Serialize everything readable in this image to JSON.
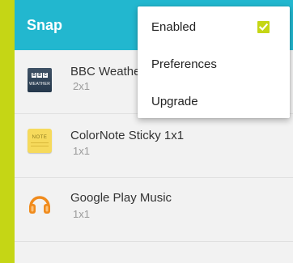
{
  "appbar": {
    "title": "Snap"
  },
  "list": {
    "items": [
      {
        "title": "BBC Weather",
        "subtitle": "2x1",
        "icon": "bbc-weather-icon",
        "icon_text": [
          "B",
          "B",
          "C"
        ],
        "icon_caption": "WEATHER"
      },
      {
        "title": "ColorNote Sticky 1x1",
        "subtitle": "1x1",
        "icon": "colornote-icon",
        "icon_caption": "NOTE"
      },
      {
        "title": "Google Play Music",
        "subtitle": "1x1",
        "icon": "headphones-icon"
      }
    ]
  },
  "menu": {
    "items": [
      {
        "label": "Enabled",
        "checked": true
      },
      {
        "label": "Preferences"
      },
      {
        "label": "Upgrade"
      }
    ]
  },
  "colors": {
    "appbar": "#22b7cf",
    "accent": "#c5d615",
    "background": "#f2f2f2"
  }
}
